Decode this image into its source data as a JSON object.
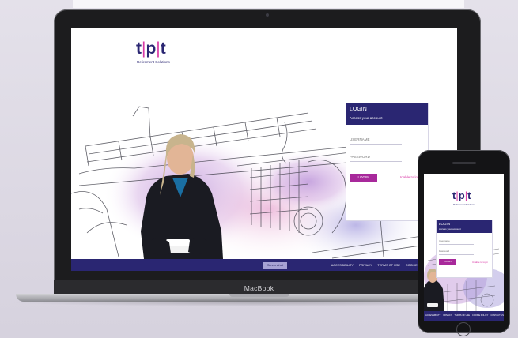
{
  "device_label": "MacBook",
  "brand": {
    "logo_t1": "t",
    "logo_bar1": "|",
    "logo_p": "p",
    "logo_bar2": "|",
    "logo_t2": "t",
    "tagline": "Retirement Solutions"
  },
  "login": {
    "title": "LOGIN",
    "subtitle": "Access your account",
    "username_placeholder": "USERNAME",
    "password_placeholder": "PASSWORD",
    "button_label": "LOGIN",
    "forgot_label": "Unable to login"
  },
  "phone_login": {
    "title": "LOGIN",
    "subtitle": "Access your account",
    "username_placeholder": "Username",
    "password_placeholder": "Password",
    "button_label": "LOGIN",
    "forgot_label": "Unable to login"
  },
  "footer": {
    "screen_badge": "Screenshot",
    "links": [
      "ACCESSIBILITY",
      "PRIVACY",
      "TERMS OF USE",
      "COOKIE POLICY",
      "CONTACT US"
    ]
  },
  "colors": {
    "brand_navy": "#2a2672",
    "brand_magenta": "#a8299b",
    "accent_pink": "#d93aa6"
  }
}
